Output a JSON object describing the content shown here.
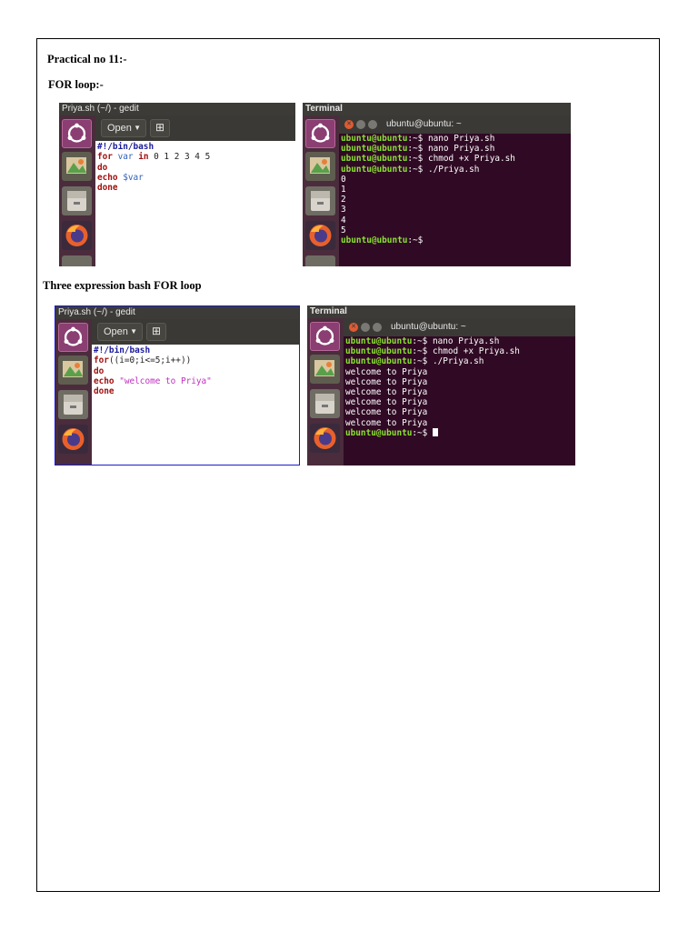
{
  "headings": {
    "practical": "Practical no 11:-",
    "for_loop": "FOR loop:-",
    "three_expr": "Three expression bash FOR loop"
  },
  "example1": {
    "gedit": {
      "window_title": "Priya.sh (~/) - gedit",
      "open_label": "Open",
      "new_icon": "new-document-icon",
      "code": {
        "line1": "#!/bin/bash",
        "line2_kw_for": "for",
        "line2_var": "var",
        "line2_kw_in": "in",
        "line2_rest": "0 1 2 3 4 5",
        "line3": "do",
        "line4_echo": "echo",
        "line4_var": "$var",
        "line5": "done"
      }
    },
    "terminal": {
      "window_title": "Terminal",
      "title": "ubuntu@ubuntu: ~",
      "prompt": "ubuntu@ubuntu",
      "prompt_tail": ":~$",
      "commands": [
        "nano Priya.sh",
        "nano Priya.sh",
        "chmod +x Priya.sh",
        "./Priya.sh"
      ],
      "output": [
        "0",
        "1",
        "2",
        "3",
        "4",
        "5"
      ]
    }
  },
  "example2": {
    "gedit": {
      "window_title": "Priya.sh (~/) - gedit",
      "open_label": "Open",
      "new_icon": "new-document-icon",
      "code": {
        "line1": "#!/bin/bash",
        "line2_kw_for": "for",
        "line2_rest": "((i=0;i<=5;i++))",
        "line3": "do",
        "line4_echo": "echo",
        "line4_str": "\"welcome to Priya\"",
        "line5": "done"
      }
    },
    "terminal": {
      "window_title": "Terminal",
      "title": "ubuntu@ubuntu: ~",
      "prompt": "ubuntu@ubuntu",
      "prompt_tail": ":~$",
      "commands": [
        "nano Priya.sh",
        "chmod +x Priya.sh",
        "./Priya.sh"
      ],
      "output": [
        "welcome to Priya",
        "welcome to Priya",
        "welcome to Priya",
        "welcome to Priya",
        "welcome to Priya",
        "welcome to Priya"
      ]
    }
  },
  "launcher_icons": [
    "ubuntu-dash-icon",
    "image-viewer-icon",
    "files-icon",
    "firefox-icon"
  ],
  "colors": {
    "terminal_bg": "#300a24",
    "prompt_green": "#8ae234",
    "keyword_red": "#a01010",
    "shebang_blue": "#1a1a9a",
    "string_magenta": "#c030c0",
    "selection_border": "#1c1ccc"
  }
}
